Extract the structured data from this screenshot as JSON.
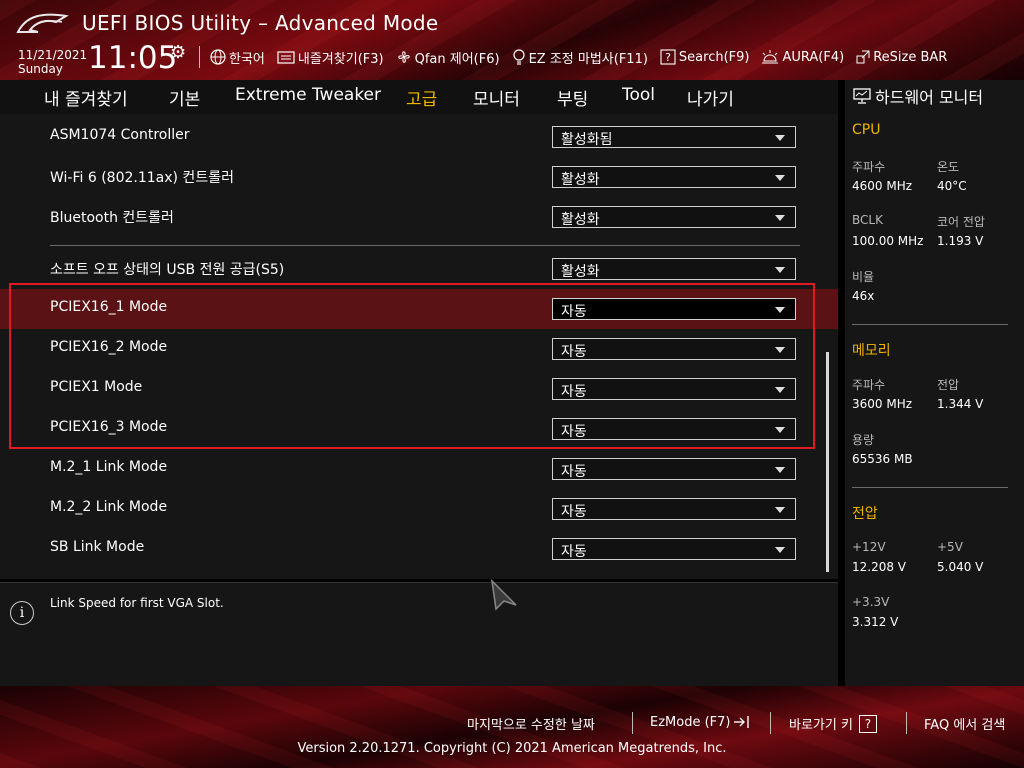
{
  "header": {
    "title": "UEFI BIOS Utility – Advanced Mode",
    "date": "11/21/2021",
    "day": "Sunday",
    "time": "11:05",
    "toolbar": [
      {
        "icon": "globe-icon",
        "label": "한국어"
      },
      {
        "icon": "favorites-icon",
        "label": "내즐겨찾기(F3)"
      },
      {
        "icon": "fan-icon",
        "label": "Qfan 제어(F6)"
      },
      {
        "icon": "bulb-icon",
        "label": "EZ 조정 마법사(F11)"
      },
      {
        "icon": "question-icon",
        "label": "Search(F9)"
      },
      {
        "icon": "aura-icon",
        "label": "AURA(F4)"
      },
      {
        "icon": "resize-bar-icon",
        "label": "ReSize BAR"
      }
    ]
  },
  "nav": {
    "tabs": [
      "내 즐겨찾기",
      "기본",
      "Extreme Tweaker",
      "고급",
      "모니터",
      "부팅",
      "Tool",
      "나가기"
    ],
    "active": "고급"
  },
  "settings": [
    {
      "label": "ASM1074 Controller",
      "value": "활성화됨"
    },
    {
      "label": "Wi-Fi 6 (802.11ax) 컨트롤러",
      "value": "활성화"
    },
    {
      "label": "Bluetooth 컨트롤러",
      "value": "활성화"
    },
    {
      "label": "소프트 오프 상태의 USB 전원 공급(S5)",
      "value": "활성화"
    },
    {
      "label": "PCIEX16_1 Mode",
      "value": "자동"
    },
    {
      "label": "PCIEX16_2 Mode",
      "value": "자동"
    },
    {
      "label": "PCIEX1 Mode",
      "value": "자동"
    },
    {
      "label": "PCIEX16_3 Mode",
      "value": "자동"
    },
    {
      "label": "M.2_1 Link Mode",
      "value": "자동"
    },
    {
      "label": "M.2_2 Link Mode",
      "value": "자동"
    },
    {
      "label": "SB Link Mode",
      "value": "자동"
    }
  ],
  "help": {
    "text": "Link Speed for first VGA Slot."
  },
  "hw_monitor": {
    "title": "하드웨어 모니터",
    "cpu": {
      "title": "CPU",
      "freq_label": "주파수",
      "freq": "4600 MHz",
      "temp_label": "온도",
      "temp": "40°C",
      "bclk_label": "BCLK",
      "bclk": "100.00 MHz",
      "vcore_label": "코어 전압",
      "vcore": "1.193 V",
      "ratio_label": "비율",
      "ratio": "46x"
    },
    "memory": {
      "title": "메모리",
      "freq_label": "주파수",
      "freq": "3600 MHz",
      "volt_label": "전압",
      "volt": "1.344 V",
      "cap_label": "용량",
      "cap": "65536 MB"
    },
    "voltage": {
      "title": "전압",
      "v12_label": "+12V",
      "v12": "12.208 V",
      "v5_label": "+5V",
      "v5": "5.040 V",
      "v33_label": "+3.3V",
      "v33": "3.312 V"
    }
  },
  "footer": {
    "last_modified": "마지막으로 수정한 날짜",
    "ezmode": "EzMode (F7)",
    "hotkeys": "바로가기 키",
    "faq": "FAQ 에서 검색",
    "version": "Version 2.20.1271. Copyright (C) 2021 American Megatrends, Inc."
  },
  "colors": {
    "accent": "#f0b400",
    "highlight_row": "#5a1214",
    "red_box": "#e01a22"
  }
}
